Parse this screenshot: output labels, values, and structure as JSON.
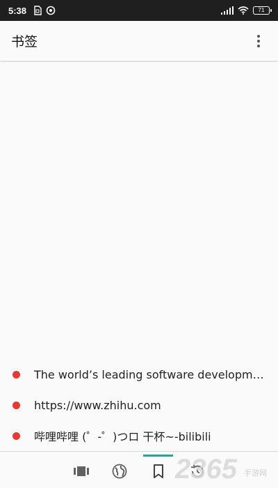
{
  "status_bar": {
    "time": "5:38",
    "battery": "71",
    "icons": [
      "sim-card-icon",
      "sync-icon",
      "signal-icon",
      "wifi-icon",
      "battery-icon"
    ]
  },
  "app_bar": {
    "title": "书签",
    "menu_icon": "more-vert-icon"
  },
  "bookmarks": [
    {
      "title": "The world’s leading software developm…",
      "dot_color": "#e53935"
    },
    {
      "title": "https://www.zhihu.com",
      "dot_color": "#e53935"
    },
    {
      "title": "哔哩哔哩 (゜-゜)つロ 干杯~-bilibili",
      "dot_color": "#e53935"
    }
  ],
  "bottom_nav": {
    "items": [
      {
        "name": "tabs",
        "icon": "tabs-icon"
      },
      {
        "name": "globe",
        "icon": "globe-icon"
      },
      {
        "name": "bookmarks",
        "icon": "bookmark-icon",
        "active": true
      },
      {
        "name": "history",
        "icon": "history-icon"
      }
    ],
    "accent": "#26a69a"
  },
  "watermark": {
    "text": "2365",
    "subtext": "手游网"
  }
}
